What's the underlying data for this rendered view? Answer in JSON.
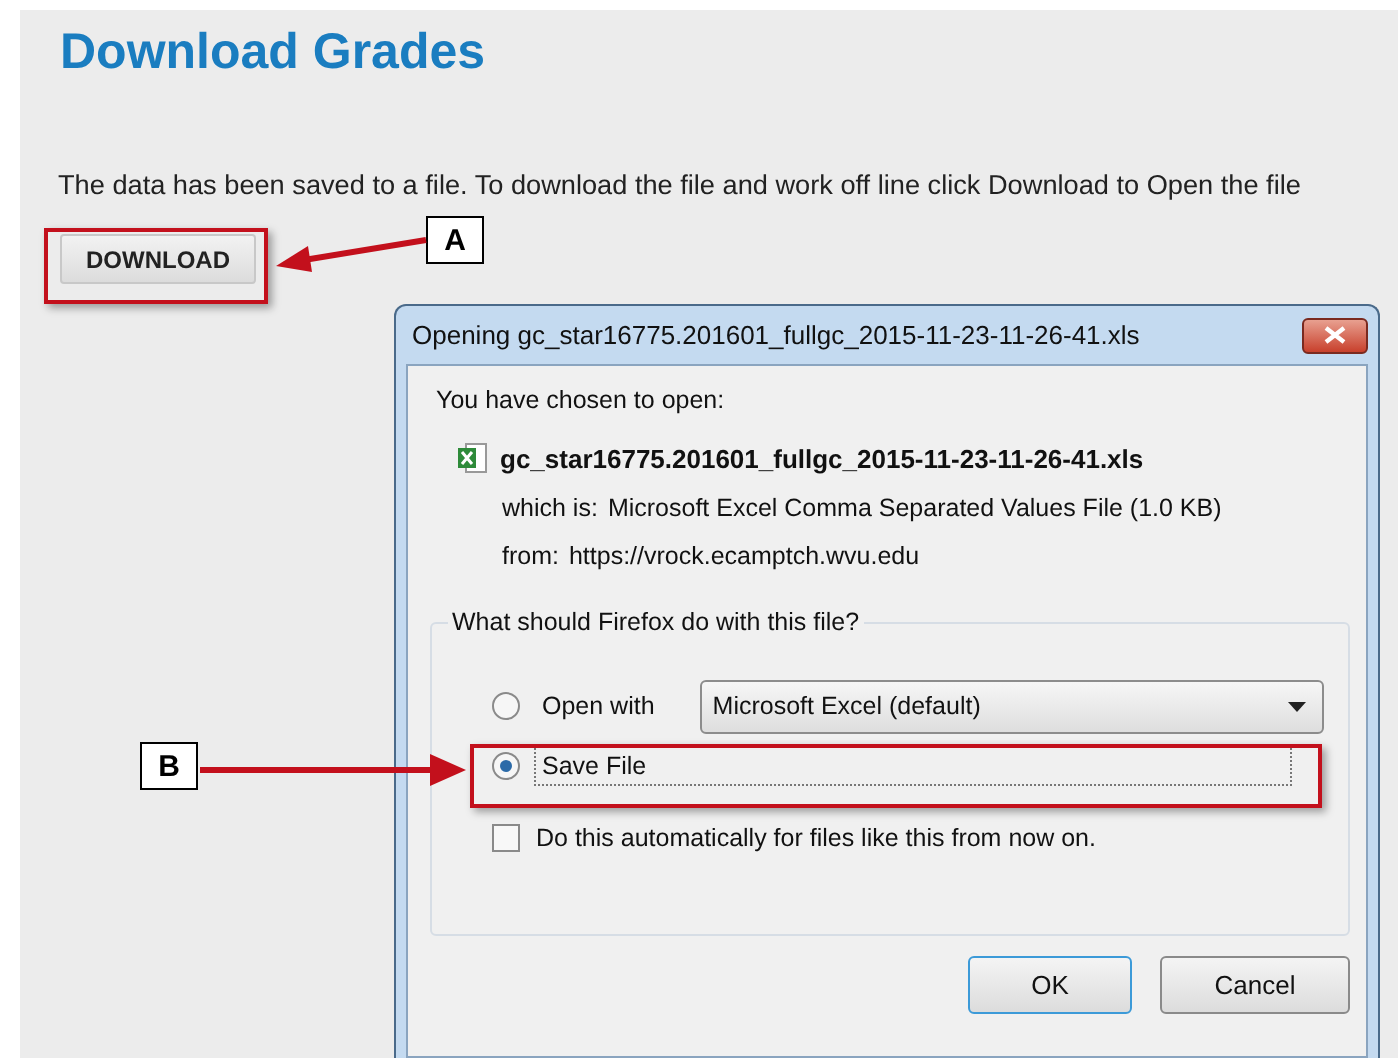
{
  "page": {
    "title": "Download Grades",
    "message": "The data has been saved to a file. To download the file and work off line click Download to Open the file",
    "download_button": "DOWNLOAD"
  },
  "dialog": {
    "title": "Opening gc_star16775.201601_fullgc_2015-11-23-11-26-41.xls",
    "intro": "You have chosen to open:",
    "file_name": "gc_star16775.201601_fullgc_2015-11-23-11-26-41.xls",
    "details": [
      {
        "label": "which is:",
        "value": "Microsoft Excel Comma Separated Values File (1.0 KB)"
      },
      {
        "label": "from:",
        "value": "https://vrock.ecamptch.wvu.edu"
      }
    ],
    "group_label": "What should Firefox do with this file?",
    "options": [
      {
        "kind": "app",
        "label": "Open with",
        "selected": false,
        "app": "Microsoft Excel (default)"
      },
      {
        "kind": "plain",
        "label": "Save File",
        "selected": true
      }
    ],
    "auto_checkbox": {
      "label": "Do this automatically for files like this from now on.",
      "checked": false
    },
    "buttons": [
      {
        "label": "OK",
        "default": true
      },
      {
        "label": "Cancel",
        "default": false
      }
    ]
  },
  "annotations": [
    {
      "label": "A"
    },
    {
      "label": "B"
    }
  ]
}
